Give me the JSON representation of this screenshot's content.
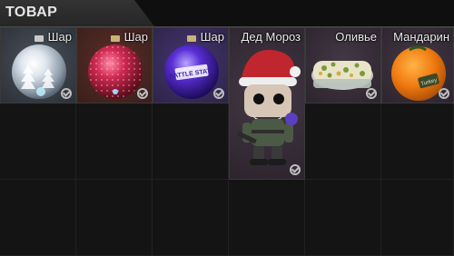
{
  "tab": {
    "title": "ТОВАР"
  },
  "items": [
    {
      "label": "Шар",
      "icon": "ornament-ball-silver-icon",
      "bg": "#3a3f48"
    },
    {
      "label": "Шар",
      "icon": "ornament-ball-red-icon",
      "bg": "#4a2722"
    },
    {
      "label": "Шар",
      "icon": "ornament-ball-purple-icon",
      "bg": "#3b2e5c",
      "ornament_text": "BATTLE STATE"
    },
    {
      "label": "Дед Мороз",
      "icon": "ded-moroz-figurine-icon",
      "bg": "#3a2f3c"
    },
    {
      "label": "Оливье",
      "icon": "olivier-salad-icon",
      "bg": "#3a2f3c"
    },
    {
      "label": "Мандарин",
      "icon": "tangerine-icon",
      "bg": "#3a2f3c",
      "sticker_text": "Turkey"
    }
  ]
}
